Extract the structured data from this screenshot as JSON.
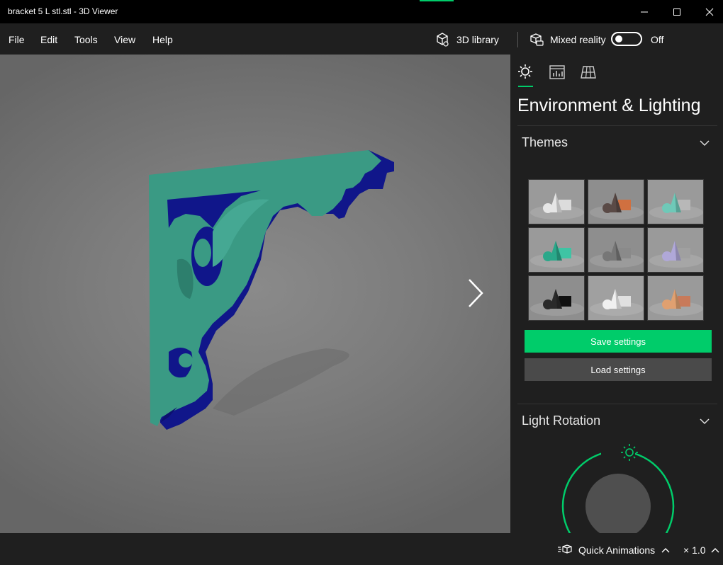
{
  "window": {
    "title": "bracket 5 L stl.stl - 3D Viewer"
  },
  "menu": {
    "file": "File",
    "edit": "Edit",
    "tools": "Tools",
    "view": "View",
    "help": "Help"
  },
  "toolbar": {
    "library_label": "3D library",
    "mixed_reality_label": "Mixed reality",
    "mixed_reality_state": "Off"
  },
  "panel": {
    "title": "Environment & Lighting",
    "themes_header": "Themes",
    "themes": [
      {
        "name": "white",
        "bg": "#9a9a9a",
        "shape": "#e6e6e6",
        "box": "#dcdcdc"
      },
      {
        "name": "warm",
        "bg": "#8e8e8e",
        "shape": "#5a4a46",
        "box": "#d07040"
      },
      {
        "name": "teal",
        "bg": "#9a9a9a",
        "shape": "#6fc9b8",
        "box": "#b8b8b8"
      },
      {
        "name": "green",
        "bg": "#9a9a9a",
        "shape": "#2aa88a",
        "box": "#3fc4a4"
      },
      {
        "name": "grey",
        "bg": "#8e8e8e",
        "shape": "#777777",
        "box": "#8a8a8a"
      },
      {
        "name": "lavender",
        "bg": "#9a9a9a",
        "shape": "#b0a8d8",
        "box": "#a0a0a0"
      },
      {
        "name": "dark",
        "bg": "#8e8e8e",
        "shape": "#2a2a2a",
        "box": "#111111"
      },
      {
        "name": "light",
        "bg": "#a0a0a0",
        "shape": "#f0f0f0",
        "box": "#e0e0e0"
      },
      {
        "name": "sunset",
        "bg": "#9a9a9a",
        "shape": "#e0a070",
        "box": "#c87a5a"
      }
    ],
    "save_label": "Save settings",
    "load_label": "Load settings",
    "rotation_header": "Light Rotation"
  },
  "status": {
    "quick_animations_label": "Quick Animations",
    "speed": "× 1.0"
  },
  "colors": {
    "accent": "#00cc6a",
    "model_face": "#3a9a84",
    "model_side": "#10168a"
  }
}
